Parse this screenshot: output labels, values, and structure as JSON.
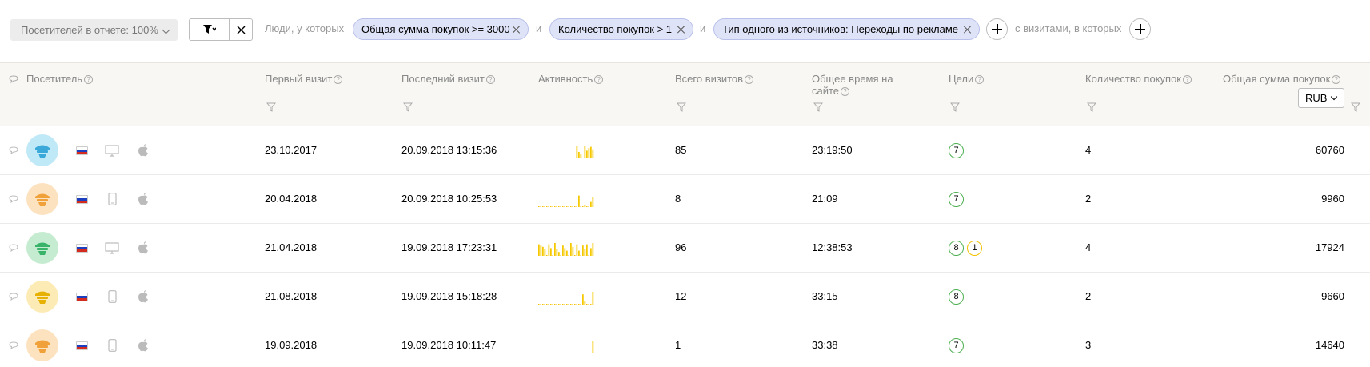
{
  "filterbar": {
    "sampling_label": "Посетителей в отчете: 100%",
    "people_text": "Люди, у которых",
    "and_1": "и",
    "and_2": "и",
    "visits_text": "с визитами, в которых",
    "chips": [
      {
        "label": "Общая сумма покупок >= 3000"
      },
      {
        "label": "Количество покупок > 1"
      },
      {
        "label": "Тип одного из источников: Переходы по рекламе"
      }
    ]
  },
  "table": {
    "headers": {
      "visitor": "Посетитель",
      "first_visit": "Первый визит",
      "last_visit": "Последний визит",
      "activity": "Активность",
      "total_visits": "Всего визитов",
      "total_time_1": "Общее время на",
      "total_time_2": "сайте",
      "goals": "Цели",
      "purchases": "Количество покупок",
      "revenue": "Общая сумма покупок",
      "currency": "RUB"
    },
    "rows": [
      {
        "avatar_color": "#bfe9f7",
        "icon_color": "#3aa8d8",
        "device": "desktop",
        "first": "23.10.2017",
        "last": "20.09.2018 13:15:36",
        "activity": [
          0,
          0,
          0,
          0,
          0,
          0,
          0,
          0,
          0,
          0,
          0,
          0,
          0,
          0,
          0,
          0,
          0,
          0,
          0,
          1,
          0.5,
          0.3,
          0,
          1,
          0.6,
          0.8,
          0.9,
          0.7
        ],
        "visits": "85",
        "time": "23:19:50",
        "goals": [
          {
            "n": "7",
            "c": "green"
          }
        ],
        "purchases": "4",
        "revenue": "60760"
      },
      {
        "avatar_color": "#fde2bf",
        "icon_color": "#f0a13a",
        "device": "mobile",
        "first": "20.04.2018",
        "last": "20.09.2018 10:25:53",
        "activity": [
          0,
          0,
          0,
          0,
          0,
          0,
          0,
          0,
          0,
          0,
          0,
          0,
          0,
          0,
          0,
          0,
          0,
          0,
          0,
          0,
          0.9,
          0,
          0,
          0.2,
          0,
          0,
          0.4,
          0.8
        ],
        "visits": "8",
        "time": "21:09",
        "goals": [
          {
            "n": "7",
            "c": "green"
          }
        ],
        "purchases": "2",
        "revenue": "9960"
      },
      {
        "avatar_color": "#c5ecd0",
        "icon_color": "#3ab36a",
        "device": "desktop",
        "first": "21.04.2018",
        "last": "19.09.2018 17:23:31",
        "activity": [
          0.9,
          0.8,
          0.7,
          0.5,
          0,
          0.9,
          0.6,
          0,
          1,
          0.5,
          0.3,
          0,
          0.8,
          0.6,
          0.4,
          0,
          1,
          0.7,
          0,
          0.9,
          0.4,
          0,
          0.8,
          0.5,
          0.9,
          0,
          0.6,
          1
        ],
        "visits": "96",
        "time": "12:38:53",
        "goals": [
          {
            "n": "8",
            "c": "green"
          },
          {
            "n": "1",
            "c": "yellow"
          }
        ],
        "purchases": "4",
        "revenue": "17924"
      },
      {
        "avatar_color": "#fdebb5",
        "icon_color": "#e6b100",
        "device": "mobile",
        "first": "21.08.2018",
        "last": "19.09.2018 15:18:28",
        "activity": [
          0,
          0,
          0,
          0,
          0,
          0,
          0,
          0,
          0,
          0,
          0,
          0,
          0,
          0,
          0,
          0,
          0,
          0,
          0,
          0,
          0,
          0,
          0.8,
          0.3,
          0,
          0,
          0,
          1
        ],
        "visits": "12",
        "time": "33:15",
        "goals": [
          {
            "n": "8",
            "c": "green"
          }
        ],
        "purchases": "2",
        "revenue": "9660"
      },
      {
        "avatar_color": "#fde2bf",
        "icon_color": "#f0a13a",
        "device": "mobile",
        "first": "19.09.2018",
        "last": "19.09.2018 10:11:47",
        "activity": [
          0,
          0,
          0,
          0,
          0,
          0,
          0,
          0,
          0,
          0,
          0,
          0,
          0,
          0,
          0,
          0,
          0,
          0,
          0,
          0,
          0,
          0,
          0,
          0,
          0,
          0,
          0,
          1
        ],
        "visits": "1",
        "time": "33:38",
        "goals": [
          {
            "n": "7",
            "c": "green"
          }
        ],
        "purchases": "3",
        "revenue": "14640"
      }
    ]
  }
}
